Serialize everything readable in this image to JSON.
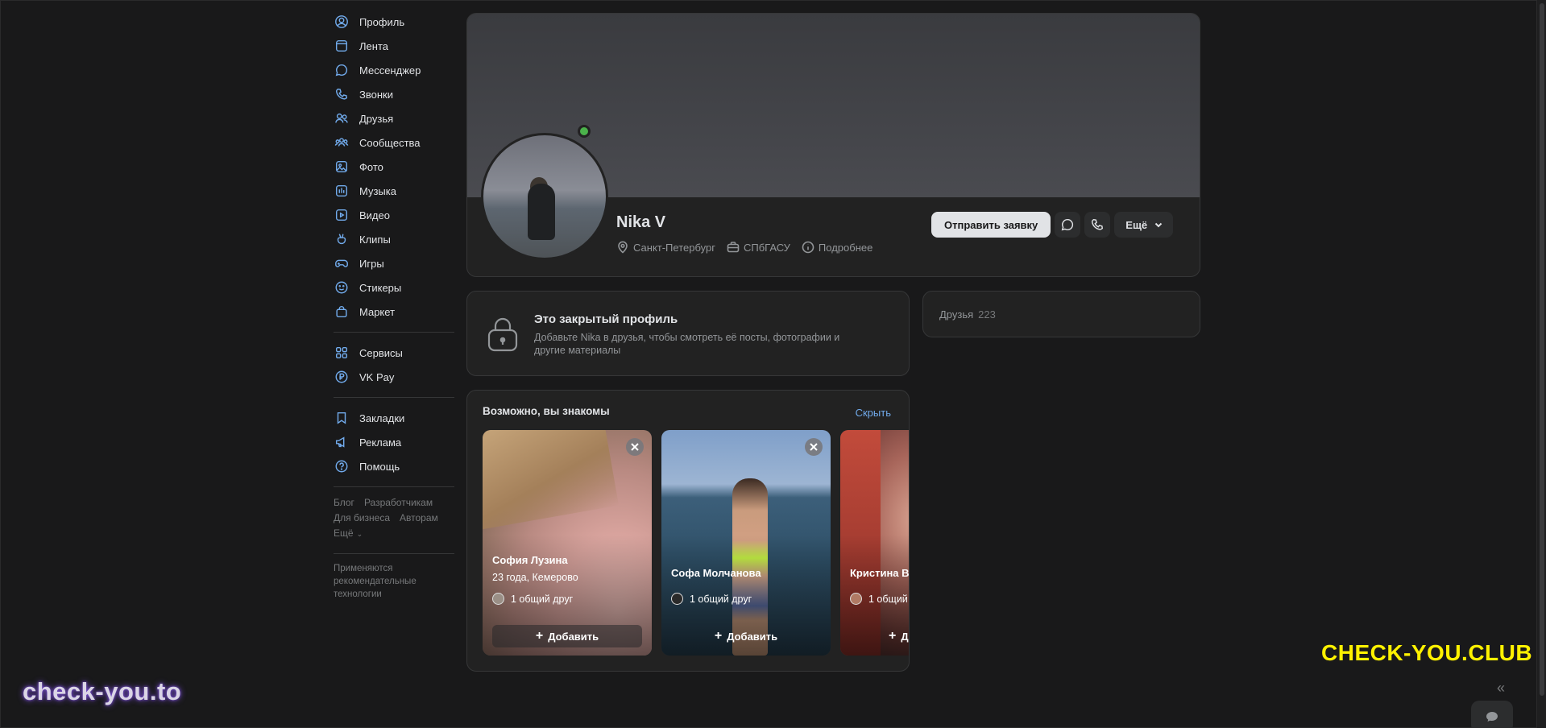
{
  "sidebar": {
    "items": [
      {
        "label": "Профиль",
        "icon": "user-circle-icon"
      },
      {
        "label": "Лента",
        "icon": "feed-icon"
      },
      {
        "label": "Мессенджер",
        "icon": "message-icon"
      },
      {
        "label": "Звонки",
        "icon": "phone-icon"
      },
      {
        "label": "Друзья",
        "icon": "users-icon"
      },
      {
        "label": "Сообщества",
        "icon": "communities-icon"
      },
      {
        "label": "Фото",
        "icon": "photo-icon"
      },
      {
        "label": "Музыка",
        "icon": "music-icon"
      },
      {
        "label": "Видео",
        "icon": "video-icon"
      },
      {
        "label": "Клипы",
        "icon": "clips-icon"
      },
      {
        "label": "Игры",
        "icon": "gamepad-icon"
      },
      {
        "label": "Стикеры",
        "icon": "smile-icon"
      },
      {
        "label": "Маркет",
        "icon": "bag-icon"
      }
    ],
    "items2": [
      {
        "label": "Сервисы",
        "icon": "grid-icon"
      },
      {
        "label": "VK Pay",
        "icon": "vkpay-icon"
      }
    ],
    "items3": [
      {
        "label": "Закладки",
        "icon": "bookmark-icon"
      },
      {
        "label": "Реклама",
        "icon": "megaphone-icon"
      },
      {
        "label": "Помощь",
        "icon": "help-icon"
      }
    ],
    "footer_links": [
      "Блог",
      "Разработчикам",
      "Для бизнеса",
      "Авторам",
      "Ещё"
    ],
    "footer_note": "Применяются рекомендательные технологии"
  },
  "profile": {
    "name": "Nika V",
    "city": "Санкт-Петербург",
    "university": "СПбГАСУ",
    "details_label": "Подробнее",
    "add_request_label": "Отправить заявку",
    "more_label": "Ещё",
    "online": true
  },
  "closed": {
    "title": "Это закрытый профиль",
    "description": "Добавьте Nika в друзья, чтобы смотреть её посты, фотографии и другие материалы"
  },
  "friends": {
    "label": "Друзья",
    "count": "223"
  },
  "suggestions": {
    "title": "Возможно, вы знакомы",
    "hide_label": "Скрыть",
    "add_label": "Добавить",
    "people": [
      {
        "name": "София Лузина",
        "sub": "23 года, Кемерово",
        "mutual": "1 общий друг"
      },
      {
        "name": "Софа Молчанова",
        "sub": "",
        "mutual": "1 общий друг"
      },
      {
        "name": "Кристина В",
        "sub": "",
        "mutual": "1 общий"
      }
    ]
  },
  "watermarks": {
    "left": "check-you.to",
    "right": "CHECK-YOU.CLUB"
  },
  "colors": {
    "accent": "#71aaeb",
    "online": "#4bb34b",
    "watermark_right": "#fff200"
  }
}
